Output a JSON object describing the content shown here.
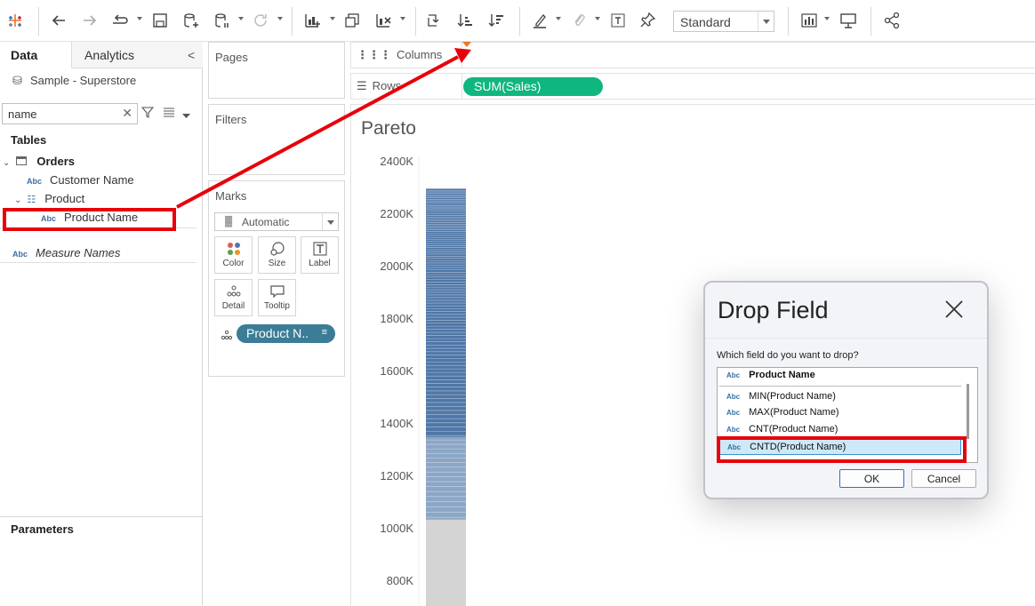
{
  "toolbar": {
    "view_style": "Standard",
    "icons": [
      "tableau-logo-icon",
      "undo-icon",
      "redo-icon",
      "replay-icon",
      "save-icon",
      "new-datasource-icon",
      "pause-updates-icon",
      "refresh-icon",
      "new-worksheet-icon",
      "duplicate-icon",
      "clear-sheet-icon",
      "swap-icon",
      "sort-ascending-icon",
      "sort-descending-icon",
      "highlight-icon",
      "group-icon",
      "show-labels-icon",
      "pin-icon",
      "show-me-icon",
      "presentation-icon",
      "share-icon"
    ]
  },
  "data_pane": {
    "tabs": {
      "data": "Data",
      "analytics": "Analytics"
    },
    "datasource": "Sample - Superstore",
    "search_value": "name",
    "tables_heading": "Tables",
    "tree": {
      "orders": "Orders",
      "customer_name": "Customer Name",
      "product": "Product",
      "product_name": "Product Name"
    },
    "measure_names": "Measure Names",
    "parameters_heading": "Parameters",
    "abc": "Abc"
  },
  "shelves": {
    "pages": "Pages",
    "filters": "Filters",
    "marks": "Marks",
    "marks_type": "Automatic",
    "marks_buttons": [
      "Color",
      "Size",
      "Label",
      "Detail",
      "Tooltip"
    ],
    "marks_pill": "Product N..",
    "columns": "Columns",
    "rows": "Rows",
    "rows_pill": "SUM(Sales)"
  },
  "view": {
    "title": "Pareto",
    "y_ticks": [
      "2400K",
      "2200K",
      "2000K",
      "1800K",
      "1600K",
      "1400K",
      "1200K",
      "1000K",
      "800K"
    ]
  },
  "chart_data": {
    "type": "bar",
    "title": "Pareto",
    "categories": [
      ""
    ],
    "series": [
      {
        "values": [
          2297
        ]
      }
    ],
    "ylim": [
      700,
      2400
    ],
    "unit": "K"
  },
  "dialog": {
    "title": "Drop Field",
    "prompt": "Which field do you want to drop?",
    "options": [
      "Product Name",
      "MIN(Product Name)",
      "MAX(Product Name)",
      "CNT(Product Name)",
      "CNTD(Product Name)"
    ],
    "selected": "CNTD(Product Name)",
    "ok": "OK",
    "cancel": "Cancel"
  },
  "annotations": {
    "color": "#e8000b"
  },
  "colors": {
    "green_pill": "#10b67f",
    "teal_pill": "#3b7c96",
    "bar_blue": "#4f77a8",
    "bar_grey": "#d4d4d4"
  }
}
